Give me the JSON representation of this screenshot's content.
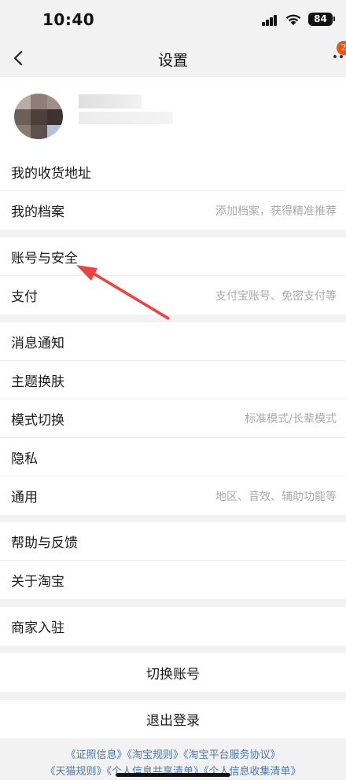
{
  "status": {
    "time": "10:40",
    "battery": "84"
  },
  "nav": {
    "title": "设置",
    "badge": "2"
  },
  "groups": {
    "profile_group": [
      {
        "label": "我的收货地址",
        "hint": ""
      },
      {
        "label": "我的档案",
        "hint": "添加档案，获得精准推荐"
      }
    ],
    "security_group": [
      {
        "label": "账号与安全",
        "hint": ""
      },
      {
        "label": "支付",
        "hint": "支付宝账号、免密支付等"
      }
    ],
    "prefs_group": [
      {
        "label": "消息通知",
        "hint": ""
      },
      {
        "label": "主题换肤",
        "hint": ""
      },
      {
        "label": "模式切换",
        "hint": "标准模式/长辈模式"
      },
      {
        "label": "隐私",
        "hint": ""
      },
      {
        "label": "通用",
        "hint": "地区、音效、辅助功能等"
      }
    ],
    "help_group": [
      {
        "label": "帮助与反馈",
        "hint": ""
      },
      {
        "label": "关于淘宝",
        "hint": ""
      }
    ],
    "merchant_group": [
      {
        "label": "商家入驻",
        "hint": ""
      }
    ]
  },
  "actions": {
    "switch_account": "切换账号",
    "logout": "退出登录"
  },
  "footer": {
    "line1": "《证照信息》《淘宝规则》《淘宝平台服务协议》",
    "line2": "《天猫规则》《个人信息共享清单》《个人信息收集清单》"
  },
  "colors": {
    "accent": "#ff5000",
    "annotation_arrow": "#f04040",
    "link": "#4a7ab5"
  },
  "icons": [
    "back-icon",
    "more-icon",
    "signal-icon",
    "wifi-icon",
    "battery-icon"
  ]
}
